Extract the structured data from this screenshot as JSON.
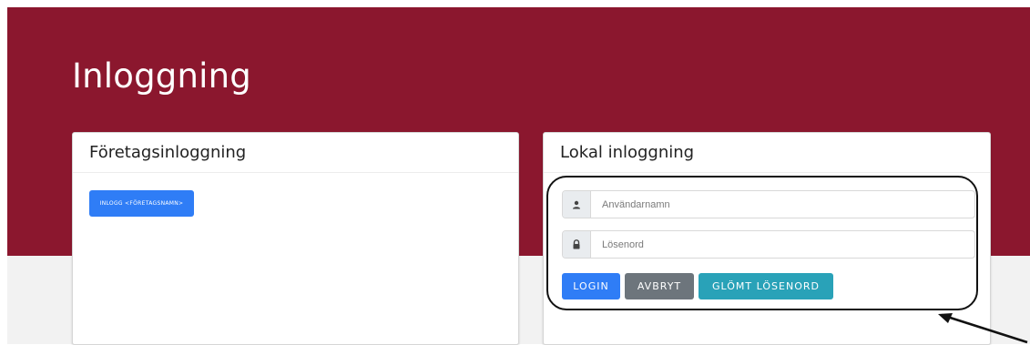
{
  "page": {
    "title": "Inloggning"
  },
  "corporate_login": {
    "title": "Företagsinloggning",
    "sso_button_label": "INLOGG <FÖRETAGSNAMN>"
  },
  "local_login": {
    "title": "Lokal inloggning",
    "username": {
      "placeholder": "Användarnamn",
      "icon": "user-icon"
    },
    "password": {
      "placeholder": "Lösenord",
      "icon": "lock-icon"
    },
    "buttons": {
      "login": "LOGIN",
      "cancel": "AVBRYT",
      "forgot": "GLÖMT LÖSENORD"
    }
  },
  "colors": {
    "banner": "#8b172e",
    "primary": "#2f7df6",
    "secondary": "#6d757c",
    "info": "#29a2b8"
  }
}
